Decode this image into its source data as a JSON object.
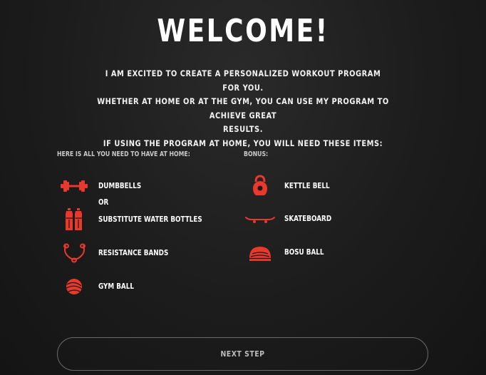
{
  "header": {
    "title": "WELCOME!"
  },
  "intro": {
    "line1": "I AM EXCITED TO CREATE A PERSONALIZED WORKOUT PROGRAM FOR YOU.",
    "line2": "WHETHER AT HOME OR AT THE GYM, YOU CAN USE MY PROGRAM TO ACHIEVE GREAT",
    "line3": "RESULTS.",
    "line4": "IF USING THE PROGRAM AT HOME, YOU WILL NEED THESE ITEMS:"
  },
  "home_list": {
    "heading": "HERE IS ALL YOU NEED TO HAVE AT HOME:",
    "items": [
      {
        "label": "DUMBBELLS",
        "icon": "dumbbell-icon"
      },
      {
        "label": "OR"
      },
      {
        "label": "SUBSTITUTE WATER BOTTLES",
        "icon": "water-bottles-icon"
      },
      {
        "label": "RESISTANCE BANDS",
        "icon": "resistance-bands-icon"
      },
      {
        "label": "GYM BALL",
        "icon": "gym-ball-icon"
      }
    ]
  },
  "bonus_list": {
    "heading": "BONUS:",
    "items": [
      {
        "label": "KETTLE BELL",
        "icon": "kettlebell-icon"
      },
      {
        "label": "SKATEBOARD",
        "icon": "skateboard-icon"
      },
      {
        "label": "BOSU BALL",
        "icon": "bosu-ball-icon"
      }
    ]
  },
  "footer": {
    "next_label": "NEXT STEP"
  },
  "colors": {
    "accent": "#e8392c",
    "background": "#1a1a1a",
    "text": "#ffffff"
  }
}
